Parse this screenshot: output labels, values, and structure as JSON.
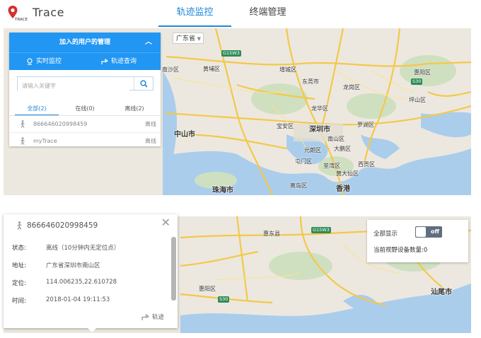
{
  "header": {
    "brand": "Trace",
    "logo_text": "TRACE",
    "tabs": [
      {
        "label": "轨迹监控",
        "active": true
      },
      {
        "label": "终端管理",
        "active": false
      }
    ]
  },
  "map_top": {
    "province": "广东省",
    "labels": [
      "南沙区",
      "黄埔区",
      "增城区",
      "惠阳区",
      "东莞市",
      "龙岗区",
      "坪山区",
      "龙华区",
      "宝安区",
      "深圳市",
      "中山市",
      "南山区",
      "罗湖区",
      "大鹏区",
      "元朗区",
      "荃湾区",
      "屯门区",
      "西贡区",
      "黄大仙区",
      "珠海市",
      "离岛区",
      "香港",
      "惠城区"
    ],
    "highways": [
      "G15W3",
      "S30"
    ]
  },
  "panel": {
    "title": "加入的用户的管理",
    "tab_realtime": "实时监控",
    "tab_track": "轨迹查询",
    "search_placeholder": "请输入关键字",
    "filters": [
      "全部(2)",
      "在线(0)",
      "离线(2)"
    ],
    "devices": [
      {
        "name": "866646020998459",
        "status": "离线"
      },
      {
        "name": "myTrace",
        "status": "离线"
      }
    ]
  },
  "map_bottom": {
    "labels": [
      "惠东县",
      "惠阳区",
      "汕尾市"
    ],
    "highways": [
      "G15W3",
      "S30"
    ]
  },
  "info_window": {
    "device_id": "866646020998459",
    "status_label": "状态:",
    "status_value": "离线（10分钟内无定位点）",
    "address_label": "地址:",
    "address_value": "广东省深圳市南山区",
    "position_label": "定位:",
    "position_value": "114.006235,22.610728",
    "time_label": "时间:",
    "time_value": "2018-01-04 19:11:53",
    "track_link": "轨迹"
  },
  "control": {
    "show_all_label": "全部显示",
    "toggle_text": "off",
    "count_label": "当前视野设备数量:0"
  },
  "colors": {
    "accent": "#2196f3",
    "water": "#abcdec",
    "land": "#ece8df",
    "road": "#f4c84a",
    "highway_badge": "#2e8b57",
    "toggle_bg": "#616e80"
  }
}
